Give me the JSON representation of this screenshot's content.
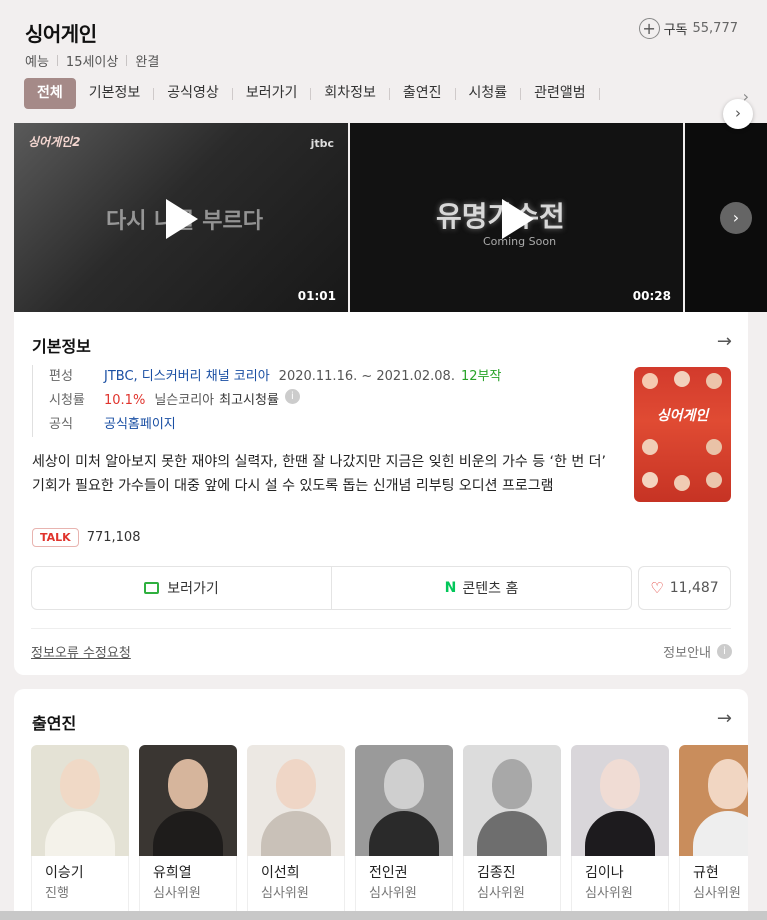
{
  "header": {
    "title": "싱어게인",
    "subscribe_label": "구독",
    "subscribe_count": "55,777",
    "meta": [
      "예능",
      "15세이상",
      "완결"
    ]
  },
  "tabs": [
    "전체",
    "기본정보",
    "공식영상",
    "보러가기",
    "회차정보",
    "출연진",
    "시청률",
    "관련앨범"
  ],
  "videos": [
    {
      "overlay": "다시 나를 부르다",
      "logo": "싱어게인2",
      "channel": "jtbc",
      "duration": "01:01"
    },
    {
      "overlay": "유명가수전",
      "subtitle": "Coming Soon",
      "duration": "00:28"
    }
  ],
  "basic_info": {
    "title": "기본정보",
    "rows": {
      "broadcast": {
        "label": "편성",
        "channel": "JTBC, 디스커버리 채널 코리아",
        "period": "2020.11.16. ~ 2021.02.08.",
        "episodes": "12부작"
      },
      "ratings": {
        "label": "시청률",
        "value": "10.1%",
        "source": "닐슨코리아",
        "note": "최고시청률"
      },
      "official": {
        "label": "공식",
        "link": "공식홈페이지"
      }
    },
    "poster_title": "싱어게인",
    "description": "세상이 미처 알아보지 못한 재야의 실력자, 한땐 잘 나갔지만 지금은 잊힌 비운의 가수 등 ‘한 번 더’ 기회가 필요한 가수들이 대중 앞에 다시 설 수 있도록 돕는 신개념 리부팅 오디션 프로그램",
    "talk_badge": "TALK",
    "talk_count": "771,108",
    "watch_label": "보러가기",
    "content_home_label": "콘텐츠 홈",
    "like_count": "11,487",
    "report_label": "정보오류 수정요청",
    "guide_label": "정보안내"
  },
  "cast": {
    "title": "출연진",
    "people": [
      {
        "name": "이승기",
        "role": "진행"
      },
      {
        "name": "유희열",
        "role": "심사위원"
      },
      {
        "name": "이선희",
        "role": "심사위원"
      },
      {
        "name": "전인권",
        "role": "심사위원"
      },
      {
        "name": "김종진",
        "role": "심사위원"
      },
      {
        "name": "김이나",
        "role": "심사위원"
      },
      {
        "name": "규현",
        "role": "심사위원"
      }
    ]
  }
}
